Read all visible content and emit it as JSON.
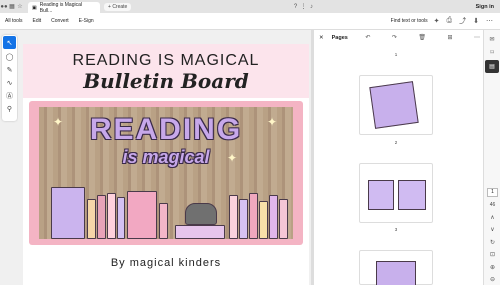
{
  "browser": {
    "tab_title": "Reading is Magical Bull...",
    "new_tab_label": "Create",
    "signin_label": "Sign in"
  },
  "menubar": {
    "items": [
      "All tools",
      "Edit",
      "Convert",
      "E-Sign"
    ],
    "search_label": "Find text or tools"
  },
  "document": {
    "title_line1": "READING IS MAGICAL",
    "title_line2": "Bulletin Board",
    "banner_reading": "READING",
    "banner_magical": "is magical",
    "byline": "By magical kinders"
  },
  "pages_panel": {
    "title": "Pages",
    "pages": [
      "1",
      "2",
      "3"
    ]
  },
  "rightbar": {
    "current_page": "1",
    "page_total": "46"
  },
  "colors": {
    "accent": "#1473e6",
    "pink": "#fce4ec",
    "lavender": "#c7a8ea"
  }
}
